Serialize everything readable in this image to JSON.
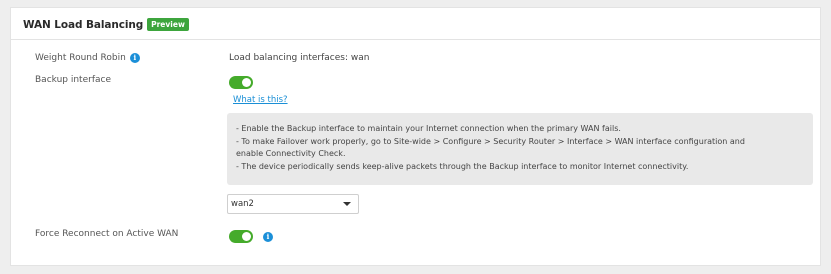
{
  "section": {
    "title": "WAN Load Balancing",
    "badge": "Preview"
  },
  "rows": {
    "weight_round_robin": {
      "label": "Weight Round Robin",
      "value": "Load balancing interfaces: wan"
    },
    "backup_interface": {
      "label": "Backup interface",
      "toggle_on": true,
      "help_link": "What is this?",
      "help_lines": [
        "- Enable the Backup interface to maintain your Internet connection when the primary WAN fails.",
        "- To make Failover work properly, go to Site-wide > Configure > Security Router > Interface > WAN interface configuration and",
        "enable Connectivity Check.",
        "- The device periodically sends keep-alive packets through the Backup interface to monitor Internet connectivity."
      ],
      "selected_interface": "wan2"
    },
    "force_reconnect": {
      "label": "Force Reconnect on Active WAN",
      "toggle_on": true
    }
  },
  "icons": {
    "info": "info-icon",
    "dropdown": "chevron-down-icon"
  },
  "colors": {
    "accent_green": "#45ab2b",
    "badge_green": "#3da53d",
    "link_blue": "#1a8fd6",
    "info_blue": "#1b8fd8"
  }
}
